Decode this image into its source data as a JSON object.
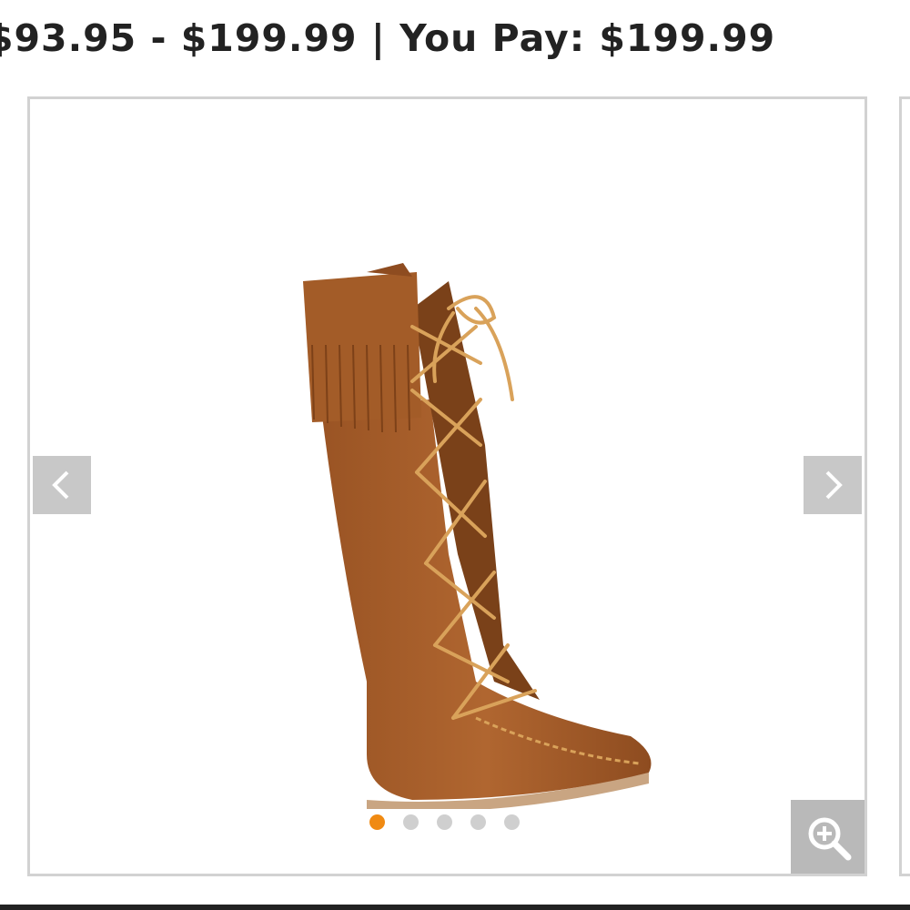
{
  "price": {
    "range_text": "$93.95 - $199.99",
    "separator": "|",
    "you_pay_label": "You Pay:",
    "you_pay_value": "$199.99"
  },
  "gallery": {
    "image_alt": "Brown suede knee-high fringe moccasin boot with leather lacing",
    "slide_count": 5,
    "active_slide": 1
  },
  "colors": {
    "dot_active": "#f08a12",
    "dot_inactive": "#cfcfcf",
    "arrow_bg": "#c8c8c8",
    "zoom_bg": "#b9b9b9",
    "suede": "#a85f2a",
    "lace": "#d9a25a"
  },
  "icons": {
    "prev": "chevron-left-icon",
    "next": "chevron-right-icon",
    "zoom": "zoom-in-icon"
  }
}
